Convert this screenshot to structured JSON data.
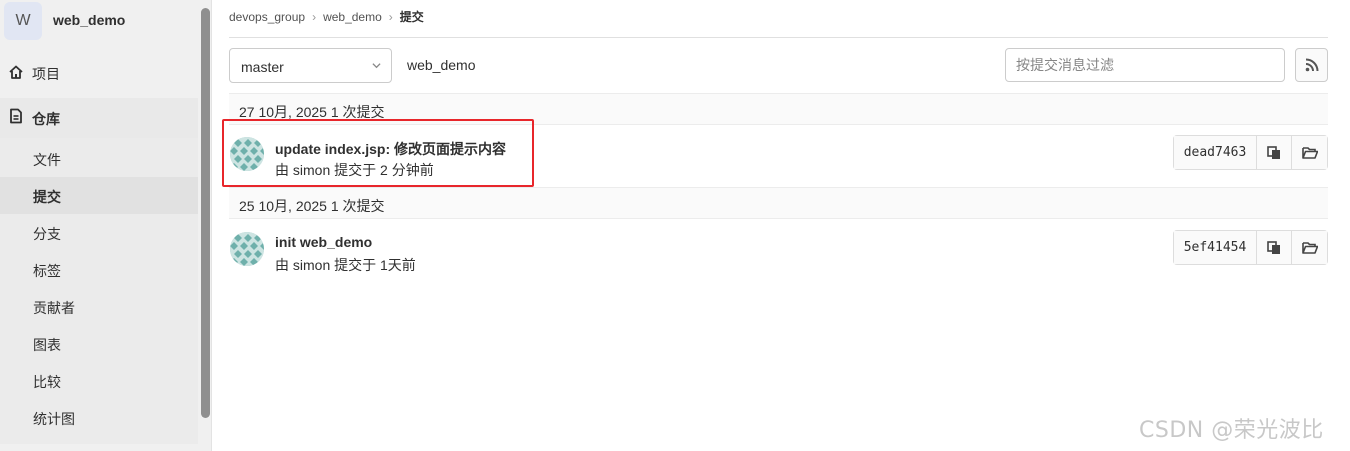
{
  "project": {
    "avatar_letter": "W",
    "name": "web_demo"
  },
  "sidebar": {
    "items": [
      {
        "label": "项目",
        "icon": "home-icon"
      },
      {
        "label": "仓库",
        "icon": "document-icon"
      }
    ],
    "repo_sub_items": [
      {
        "label": "文件"
      },
      {
        "label": "提交"
      },
      {
        "label": "分支"
      },
      {
        "label": "标签"
      },
      {
        "label": "贡献者"
      },
      {
        "label": "图表"
      },
      {
        "label": "比较"
      },
      {
        "label": "统计图"
      }
    ],
    "active_sub_item": "提交"
  },
  "breadcrumb": {
    "group": "devops_group",
    "project": "web_demo",
    "current": "提交"
  },
  "toolbar": {
    "branch": "master",
    "path": "web_demo",
    "filter_placeholder": "按提交消息过滤",
    "rss_icon": "rss-icon"
  },
  "commit_days": [
    {
      "header": "27 10月, 2025 1 次提交",
      "commits": [
        {
          "title": "update index.jsp: 修改页面提示内容",
          "meta": "由 simon 提交于 2 分钟前",
          "sha": "dead7463"
        }
      ]
    },
    {
      "header": "25 10月, 2025 1 次提交",
      "commits": [
        {
          "title": "init web_demo",
          "meta": "由 simon 提交于 1天前",
          "sha": "5ef41454"
        }
      ]
    }
  ],
  "watermark": "CSDN @荣光波比",
  "colors": {
    "highlight_border": "#e8262b",
    "avatar_teal": "#9ec9c6"
  }
}
